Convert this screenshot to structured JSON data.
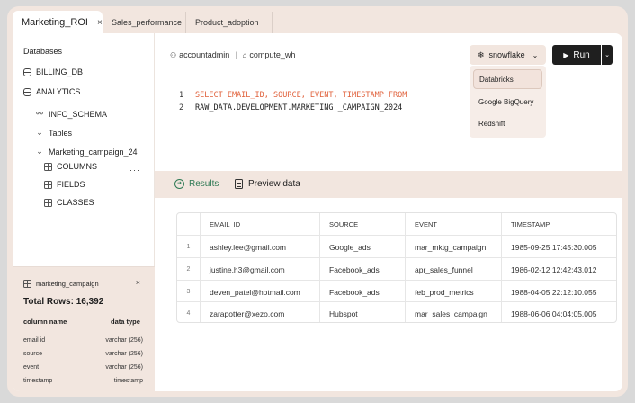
{
  "tabs": [
    {
      "label": "Marketing_ROI",
      "active": true
    },
    {
      "label": "Sales_performance",
      "active": false
    },
    {
      "label": "Product_adoption",
      "active": false
    }
  ],
  "tab_close_glyph": "×",
  "sidebar": {
    "title": "Databases",
    "tree": [
      {
        "label": "BILLING_DB",
        "icon": "database-icon"
      },
      {
        "label": "ANALYTICS",
        "icon": "database-icon"
      },
      {
        "label": "INFO_SCHEMA",
        "icon": "schema-icon"
      },
      {
        "label": "Tables",
        "icon": "chevron-down-icon"
      },
      {
        "label": "Marketing_campaign_24",
        "icon": "chevron-down-icon"
      },
      {
        "label": "COLUMNS",
        "icon": "table-icon"
      },
      {
        "label": "FIELDS",
        "icon": "table-icon"
      },
      {
        "label": "CLASSES",
        "icon": "table-icon"
      }
    ],
    "more_glyph": "···"
  },
  "info_panel": {
    "table_name": "marketing_campaign",
    "close_glyph": "×",
    "total_rows": "Total Rows: 16,392",
    "col_name_header": "column name",
    "data_type_header": "data type",
    "columns": [
      {
        "name": "email id",
        "type": "varchar (256)"
      },
      {
        "name": "source",
        "type": "varchar (256)"
      },
      {
        "name": "event",
        "type": "varchar (256)"
      },
      {
        "name": "timestamp",
        "type": "timestamp"
      }
    ]
  },
  "toolbar": {
    "user": "accountadmin",
    "warehouse": "compute_wh",
    "connector": "snowflake",
    "run_label": "Run"
  },
  "connector_dropdown": [
    "Databricks",
    "Google BigQuery",
    "Redshift"
  ],
  "editor": {
    "lines": [
      {
        "num": "1",
        "text": "SELECT EMAIL_ID, SOURCE, EVENT, TIMESTAMP FROM"
      },
      {
        "num": "2",
        "text": "RAW_DATA.DEVELOPMENT.MARKETING _CAMPAIGN_2024"
      }
    ]
  },
  "results_tabs": {
    "results": "Results",
    "preview": "Preview data"
  },
  "table": {
    "headers": [
      "EMAIL_ID",
      "SOURCE",
      "EVENT",
      "TIMESTAMP"
    ],
    "rows": [
      {
        "n": "1",
        "email": "ashley.lee@gmail.com",
        "source": "Google_ads",
        "event": "mar_mktg_campaign",
        "ts": "1985-09-25 17:45:30.005"
      },
      {
        "n": "2",
        "email": "justine.h3@gmail.com",
        "source": "Facebook_ads",
        "event": "apr_sales_funnel",
        "ts": "1986-02-12 12:42:43.012"
      },
      {
        "n": "3",
        "email": "deven_patel@hotmail.com",
        "source": "Facebook_ads",
        "event": "feb_prod_metrics",
        "ts": "1988-04-05 22:12:10.055"
      },
      {
        "n": "4",
        "email": "zarapotter@xezo.com",
        "source": "Hubspot",
        "event": "mar_sales_campaign",
        "ts": "1988-06-06 04:04:05.005"
      }
    ]
  },
  "colors": {
    "accent_green": "#2f7a55",
    "sql_keyword": "#e0603a",
    "panel_bg": "#f2e6df",
    "run_button": "#1f1f1f"
  }
}
